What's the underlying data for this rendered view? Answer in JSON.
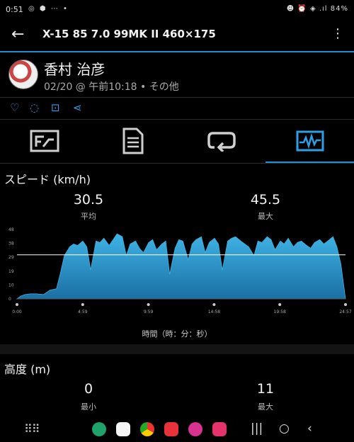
{
  "status_bar": {
    "time": "0:51",
    "left_icons": "◎ ⬢ ⋯ •",
    "right_icons": "☻ ⏰ ◈ .ıl",
    "battery": "84%"
  },
  "app_bar": {
    "title": "X-15 85 7.0 99MK II    460×175"
  },
  "profile": {
    "name": "香村 治彦",
    "meta": "02/20 @ 午前10:18 • その他"
  },
  "speed": {
    "title": "スピード (km/h)",
    "avg_value": "30.5",
    "avg_label": "平均",
    "max_value": "45.5",
    "max_label": "最大",
    "x_axis_label": "時間（時：分：秒）"
  },
  "elevation": {
    "title": "高度 (m)",
    "min_value": "0",
    "min_label": "最小",
    "max_value": "11",
    "max_label": "最大"
  },
  "colors": {
    "accent": "#1e8fd1",
    "chart_fill_top": "#3fb3e6",
    "chart_fill_bottom": "#1b6fa3"
  },
  "chart_data": {
    "type": "area",
    "title": "スピード (km/h)",
    "xlabel": "時間（時：分：秒）",
    "ylabel": "",
    "y_ticks": [
      "0",
      "10",
      "19",
      "29",
      "38",
      "48"
    ],
    "ylim": [
      0,
      48
    ],
    "x_ticks": [
      "0:00",
      "4:59",
      "9:59",
      "14:58",
      "19:58",
      "24:57"
    ],
    "avg_line": 30.5,
    "x": [
      0,
      0.3,
      0.6,
      1,
      1.5,
      2,
      2.5,
      3,
      3.3,
      3.6,
      4,
      4.3,
      4.6,
      5,
      5.3,
      5.6,
      6,
      6.3,
      6.6,
      7,
      7.3,
      7.6,
      8,
      8.3,
      8.6,
      9,
      9.3,
      9.6,
      10,
      10.3,
      10.6,
      11,
      11.3,
      11.6,
      12,
      12.3,
      12.6,
      13,
      13.3,
      13.6,
      14,
      14.3,
      14.6,
      15,
      15.3,
      15.6,
      16,
      16.3,
      16.6,
      17,
      17.3,
      17.6,
      18,
      18.3,
      18.6,
      19,
      19.3,
      19.6,
      20,
      20.3,
      20.6,
      21,
      21.3,
      21.6,
      22,
      22.3,
      22.6,
      23,
      23.3,
      23.6,
      24,
      24.3,
      24.6,
      24.95
    ],
    "values": [
      0,
      2,
      3,
      3.5,
      3.5,
      3,
      6,
      7,
      18,
      30,
      36,
      38,
      37,
      40,
      36,
      20,
      40,
      39,
      42,
      37,
      41,
      45,
      43,
      30,
      38,
      40,
      35,
      32,
      39,
      41,
      34,
      38,
      40,
      17,
      35,
      41,
      40,
      27,
      38,
      41,
      43,
      32,
      39,
      42,
      38,
      20,
      40,
      42,
      43,
      40,
      38,
      36,
      30,
      40,
      39,
      43,
      41,
      34,
      40,
      38,
      42,
      36,
      39,
      40,
      37,
      35,
      39,
      41,
      38,
      40,
      43,
      36,
      24,
      0
    ]
  }
}
